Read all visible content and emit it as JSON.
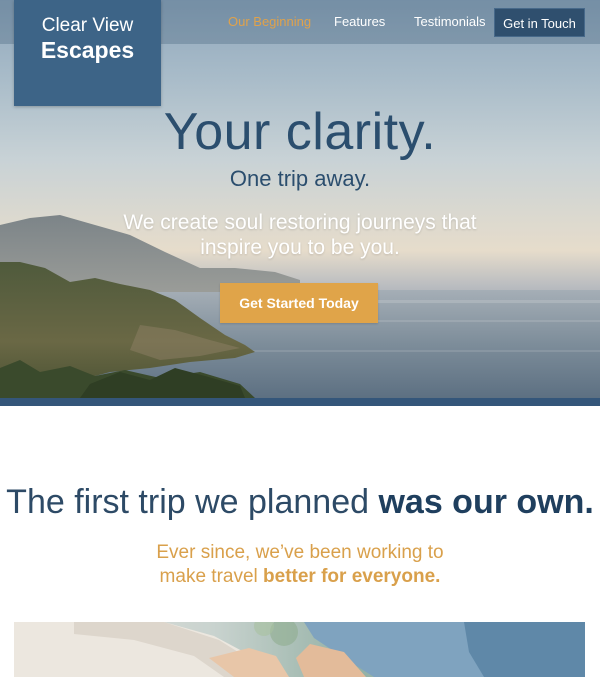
{
  "nav": {
    "logo_line1": "Clear View",
    "logo_line2": "Escapes",
    "links": [
      "Our Beginning",
      "Features",
      "Testimonials"
    ],
    "cta": "Get in Touch"
  },
  "hero": {
    "title": "Your clarity.",
    "subtitle": "One trip away.",
    "description": "We create soul restoring journeys that inspire you to be you.",
    "cta": "Get Started Today"
  },
  "story": {
    "heading_light": "The first trip we planned",
    "heading_strong": "was our own.",
    "sub_line1": "Ever since, we’ve been working to",
    "sub_line2_light": "make travel",
    "sub_line2_strong": "better for everyone."
  },
  "colors": {
    "brand_blue": "#3d6487",
    "dark_blue": "#2f4f6e",
    "accent_gold": "#e0a449",
    "active_link": "#e0a24b"
  }
}
